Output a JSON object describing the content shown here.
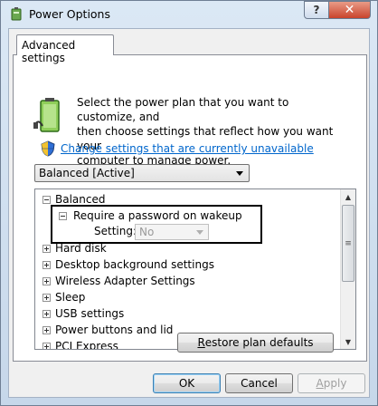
{
  "window": {
    "title": "Power Options",
    "help_label": "?",
    "close_label": "✕"
  },
  "tab": {
    "label": "Advanced settings"
  },
  "description": {
    "line1": "Select the power plan that you want to customize, and",
    "line2": "then choose settings that reflect how you want your",
    "line3": "computer to manage power."
  },
  "change_link": "Change settings that are currently unavailable",
  "plan_select": {
    "value": "Balanced [Active]"
  },
  "tree": {
    "root": "Balanced",
    "expanded_item": "Require a password on wakeup",
    "setting_label": "Setting:",
    "setting_value": "No",
    "items": [
      "Hard disk",
      "Desktop background settings",
      "Wireless Adapter Settings",
      "Sleep",
      "USB settings",
      "Power buttons and lid",
      "PCI Express"
    ]
  },
  "buttons": {
    "restore_first": "R",
    "restore_rest": "estore plan defaults",
    "ok": "OK",
    "cancel": "Cancel",
    "apply_first": "A",
    "apply_rest": "pply"
  },
  "icons": [
    "power-options-icon",
    "battery-plug-icon",
    "uac-shield-icon",
    "scroll-up-arrow-icon",
    "scroll-down-arrow-icon",
    "dropdown-arrow-icon"
  ],
  "colors": {
    "link": "#0066cc",
    "close_button": "#c9442c"
  }
}
